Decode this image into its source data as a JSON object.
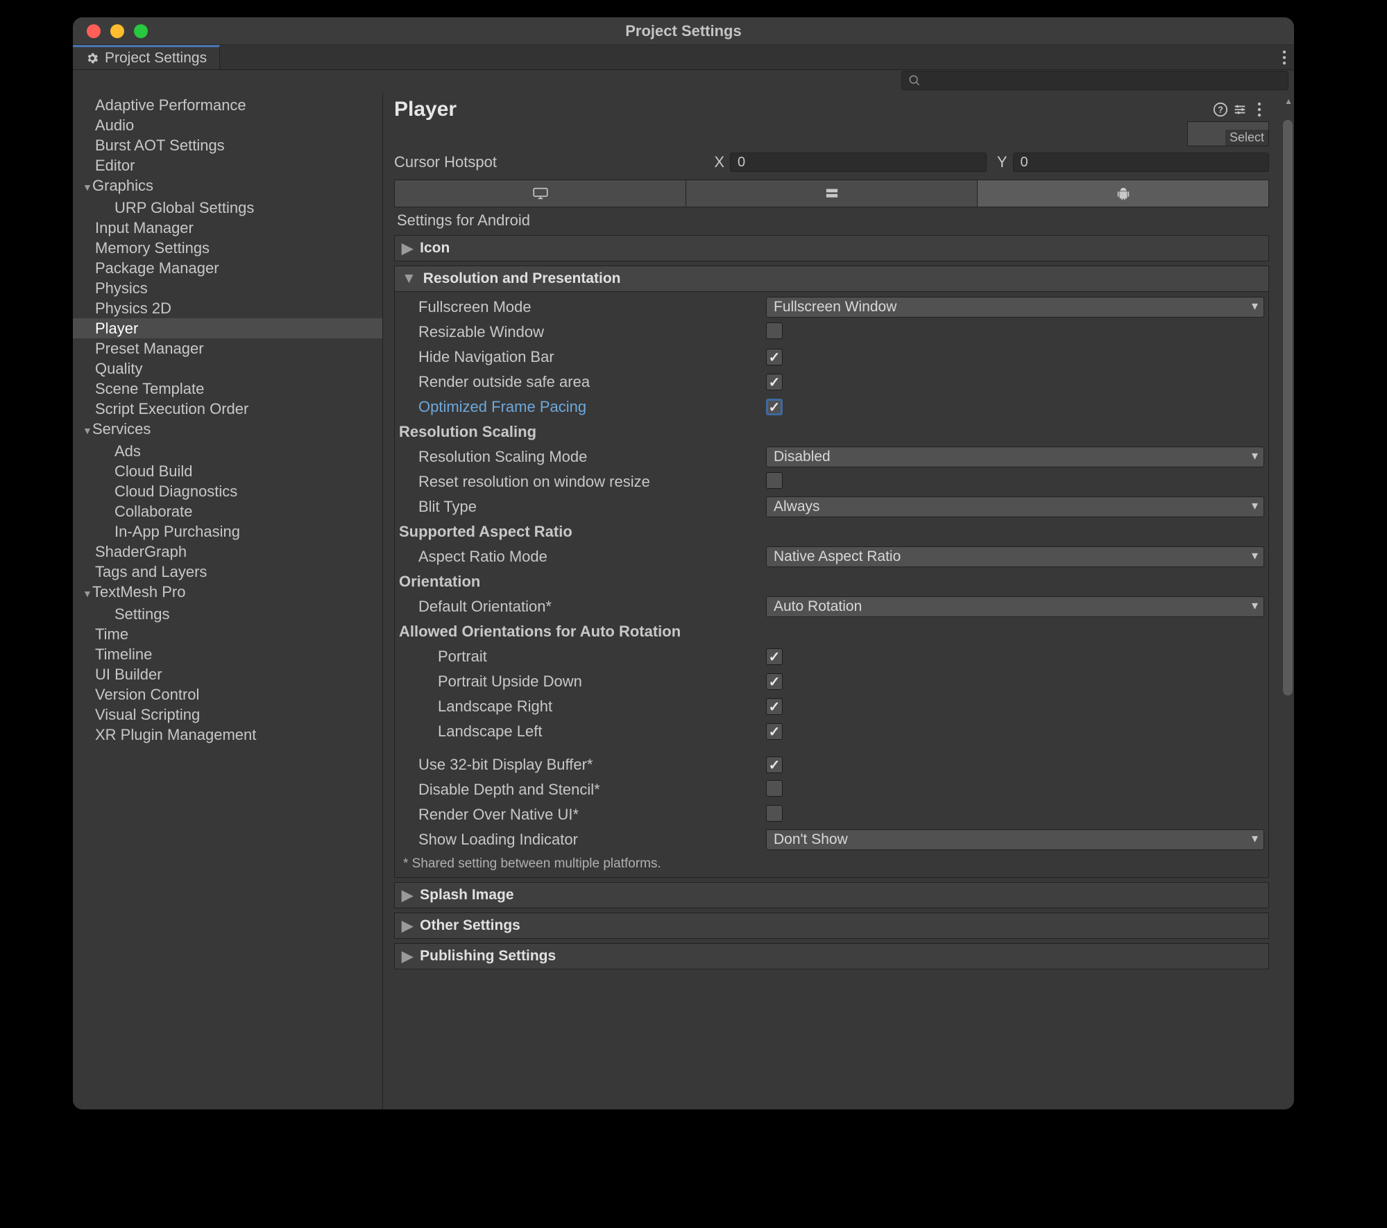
{
  "window": {
    "title": "Project Settings"
  },
  "tab": {
    "label": "Project Settings"
  },
  "sidebar": {
    "items": [
      {
        "label": "Adaptive Performance",
        "depth": 0
      },
      {
        "label": "Audio",
        "depth": 0
      },
      {
        "label": "Burst AOT Settings",
        "depth": 0
      },
      {
        "label": "Editor",
        "depth": 0
      },
      {
        "label": "Graphics",
        "depth": 0,
        "arrow": "down"
      },
      {
        "label": "URP Global Settings",
        "depth": 1
      },
      {
        "label": "Input Manager",
        "depth": 0
      },
      {
        "label": "Memory Settings",
        "depth": 0
      },
      {
        "label": "Package Manager",
        "depth": 0
      },
      {
        "label": "Physics",
        "depth": 0
      },
      {
        "label": "Physics 2D",
        "depth": 0
      },
      {
        "label": "Player",
        "depth": 0,
        "selected": true
      },
      {
        "label": "Preset Manager",
        "depth": 0
      },
      {
        "label": "Quality",
        "depth": 0
      },
      {
        "label": "Scene Template",
        "depth": 0
      },
      {
        "label": "Script Execution Order",
        "depth": 0
      },
      {
        "label": "Services",
        "depth": 0,
        "arrow": "down"
      },
      {
        "label": "Ads",
        "depth": 1
      },
      {
        "label": "Cloud Build",
        "depth": 1
      },
      {
        "label": "Cloud Diagnostics",
        "depth": 1
      },
      {
        "label": "Collaborate",
        "depth": 1
      },
      {
        "label": "In-App Purchasing",
        "depth": 1
      },
      {
        "label": "ShaderGraph",
        "depth": 0
      },
      {
        "label": "Tags and Layers",
        "depth": 0
      },
      {
        "label": "TextMesh Pro",
        "depth": 0,
        "arrow": "down"
      },
      {
        "label": "Settings",
        "depth": 1
      },
      {
        "label": "Time",
        "depth": 0
      },
      {
        "label": "Timeline",
        "depth": 0
      },
      {
        "label": "UI Builder",
        "depth": 0
      },
      {
        "label": "Version Control",
        "depth": 0
      },
      {
        "label": "Visual Scripting",
        "depth": 0
      },
      {
        "label": "XR Plugin Management",
        "depth": 0
      }
    ]
  },
  "header": {
    "title": "Player",
    "select_button": "Select"
  },
  "cursor": {
    "label": "Cursor Hotspot",
    "xlabel": "X",
    "ylabel": "Y",
    "x": "0",
    "y": "0"
  },
  "platforms": {
    "section_label": "Settings for Android"
  },
  "panels": {
    "icon": {
      "title": "Icon"
    },
    "resolution": {
      "title": "Resolution and Presentation",
      "fullscreen_mode": {
        "label": "Fullscreen Mode",
        "value": "Fullscreen Window"
      },
      "resizable_window": {
        "label": "Resizable Window",
        "checked": false
      },
      "hide_nav": {
        "label": "Hide Navigation Bar",
        "checked": true
      },
      "render_outside": {
        "label": "Render outside safe area",
        "checked": true
      },
      "frame_pacing": {
        "label": "Optimized Frame Pacing",
        "checked": true
      },
      "res_scaling_hdr": "Resolution Scaling",
      "res_scaling_mode": {
        "label": "Resolution Scaling Mode",
        "value": "Disabled"
      },
      "reset_resolution": {
        "label": "Reset resolution on window resize",
        "checked": false
      },
      "blit_type": {
        "label": "Blit Type",
        "value": "Always"
      },
      "aspect_hdr": "Supported Aspect Ratio",
      "aspect_mode": {
        "label": "Aspect Ratio Mode",
        "value": "Native Aspect Ratio"
      },
      "orientation_hdr": "Orientation",
      "default_orientation": {
        "label": "Default Orientation*",
        "value": "Auto Rotation"
      },
      "allowed_hdr": "Allowed Orientations for Auto Rotation",
      "portrait": {
        "label": "Portrait",
        "checked": true
      },
      "portrait_ud": {
        "label": "Portrait Upside Down",
        "checked": true
      },
      "landscape_r": {
        "label": "Landscape Right",
        "checked": true
      },
      "landscape_l": {
        "label": "Landscape Left",
        "checked": true
      },
      "use_32bit": {
        "label": "Use 32-bit Display Buffer*",
        "checked": true
      },
      "disable_depth": {
        "label": "Disable Depth and Stencil*",
        "checked": false
      },
      "render_over_native": {
        "label": "Render Over Native UI*",
        "checked": false
      },
      "loading_indicator": {
        "label": "Show Loading Indicator",
        "value": "Don't Show"
      },
      "footnote": "* Shared setting between multiple platforms."
    },
    "splash": {
      "title": "Splash Image"
    },
    "other": {
      "title": "Other Settings"
    },
    "publishing": {
      "title": "Publishing Settings"
    }
  }
}
